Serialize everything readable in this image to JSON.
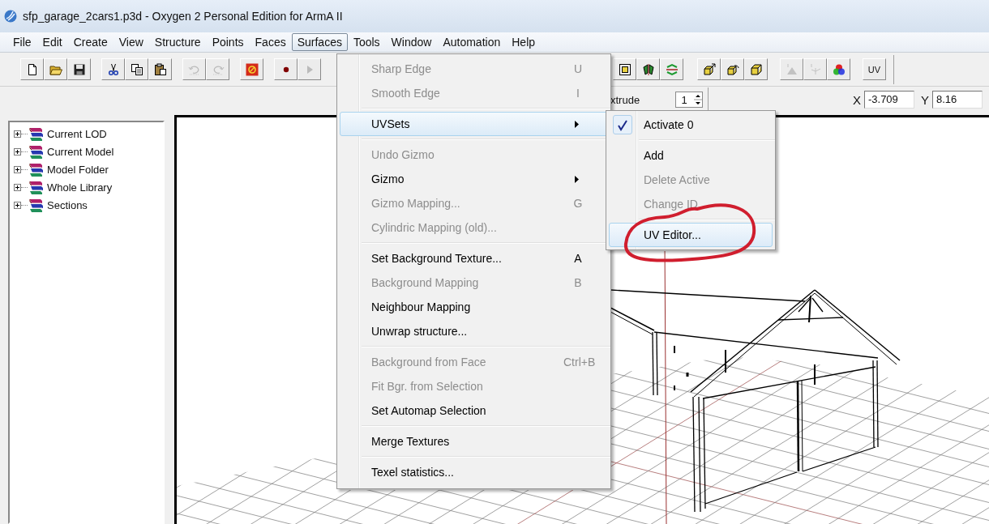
{
  "window": {
    "title": "sfp_garage_2cars1.p3d - Oxygen 2 Personal Edition for ArmA II"
  },
  "menubar": [
    {
      "label": "File",
      "selected": false
    },
    {
      "label": "Edit",
      "selected": false
    },
    {
      "label": "Create",
      "selected": false
    },
    {
      "label": "View",
      "selected": false
    },
    {
      "label": "Structure",
      "selected": false
    },
    {
      "label": "Points",
      "selected": false
    },
    {
      "label": "Faces",
      "selected": false
    },
    {
      "label": "Surfaces",
      "selected": true
    },
    {
      "label": "Tools",
      "selected": false
    },
    {
      "label": "Window",
      "selected": false
    },
    {
      "label": "Automation",
      "selected": false
    },
    {
      "label": "Help",
      "selected": false
    }
  ],
  "toolbar": {
    "left": [
      {
        "disabled": false
      },
      {
        "disabled": false
      },
      {
        "disabled": false
      },
      {
        "disabled": false
      },
      {
        "disabled": false
      },
      {
        "disabled": false
      },
      {
        "disabled": true
      },
      {
        "disabled": true
      },
      {
        "disabled": false
      },
      {
        "disabled": false
      },
      {
        "disabled": true
      }
    ],
    "right": [
      {
        "disabled": false
      },
      {
        "disabled": false
      },
      {
        "disabled": false
      },
      {
        "disabled": false
      },
      {
        "disabled": false
      },
      {
        "disabled": false
      },
      {
        "disabled": true
      },
      {
        "disabled": true
      },
      {
        "disabled": false
      }
    ],
    "uv_button": {
      "label": "UV"
    },
    "extrude_label": "xtrude",
    "spinner_value": "1",
    "coordinates": [
      {
        "axis": "X",
        "value": "-3.709"
      },
      {
        "axis": "Y",
        "value": "8.16"
      }
    ]
  },
  "tree": [
    {
      "label": "Current LOD",
      "expanded": false
    },
    {
      "label": "Current Model",
      "expanded": false
    },
    {
      "label": "Model Folder",
      "expanded": false
    },
    {
      "label": "Whole Library",
      "expanded": false
    },
    {
      "label": "Sections",
      "expanded": false
    }
  ],
  "menu": {
    "items": [
      {
        "kind": "item",
        "label": "Sharp Edge",
        "shortcut": "U",
        "disabled": true,
        "selected": false,
        "submenu": false
      },
      {
        "kind": "item",
        "label": "Smooth Edge",
        "shortcut": "I",
        "disabled": true,
        "selected": false,
        "submenu": false
      },
      {
        "kind": "separator"
      },
      {
        "kind": "item",
        "label": "UVSets",
        "disabled": false,
        "selected": true,
        "submenu": true
      },
      {
        "kind": "separator"
      },
      {
        "kind": "item",
        "label": "Undo Gizmo",
        "disabled": true,
        "selected": false,
        "submenu": false
      },
      {
        "kind": "item",
        "label": "Gizmo",
        "disabled": false,
        "selected": false,
        "submenu": true
      },
      {
        "kind": "item",
        "label": "Gizmo Mapping...",
        "shortcut": "G",
        "disabled": true,
        "selected": false,
        "submenu": false
      },
      {
        "kind": "item",
        "label": "Cylindric Mapping (old)...",
        "disabled": true,
        "selected": false,
        "submenu": false
      },
      {
        "kind": "separator"
      },
      {
        "kind": "item",
        "label": "Set Background Texture...",
        "shortcut": "A",
        "disabled": false,
        "selected": false,
        "submenu": false
      },
      {
        "kind": "item",
        "label": "Background Mapping",
        "shortcut": "B",
        "disabled": true,
        "selected": false,
        "submenu": false
      },
      {
        "kind": "item",
        "label": "Neighbour Mapping",
        "disabled": false,
        "selected": false,
        "submenu": false
      },
      {
        "kind": "item",
        "label": "Unwrap structure...",
        "disabled": false,
        "selected": false,
        "submenu": false
      },
      {
        "kind": "separator"
      },
      {
        "kind": "item",
        "label": "Background from Face",
        "shortcut": "Ctrl+B",
        "disabled": true,
        "selected": false,
        "submenu": false
      },
      {
        "kind": "item",
        "label": "Fit Bgr. from Selection",
        "disabled": true,
        "selected": false,
        "submenu": false
      },
      {
        "kind": "item",
        "label": "Set Automap Selection",
        "disabled": false,
        "selected": false,
        "submenu": false
      },
      {
        "kind": "separator"
      },
      {
        "kind": "item",
        "label": "Merge Textures",
        "disabled": false,
        "selected": false,
        "submenu": false
      },
      {
        "kind": "separator"
      },
      {
        "kind": "item",
        "label": "Texel statistics...",
        "disabled": false,
        "selected": false,
        "submenu": false
      }
    ]
  },
  "submenu": {
    "items": [
      {
        "kind": "item",
        "label": "Activate 0",
        "checked": true,
        "disabled": false,
        "selected": false
      },
      {
        "kind": "separator"
      },
      {
        "kind": "item",
        "label": "Add",
        "checked": false,
        "disabled": false,
        "selected": false
      },
      {
        "kind": "item",
        "label": "Delete Active",
        "checked": false,
        "disabled": true,
        "selected": false
      },
      {
        "kind": "item",
        "label": "Change ID",
        "checked": false,
        "disabled": true,
        "selected": false
      },
      {
        "kind": "separator"
      },
      {
        "kind": "item",
        "label": "UV Editor...",
        "checked": false,
        "disabled": false,
        "selected": true
      }
    ]
  }
}
